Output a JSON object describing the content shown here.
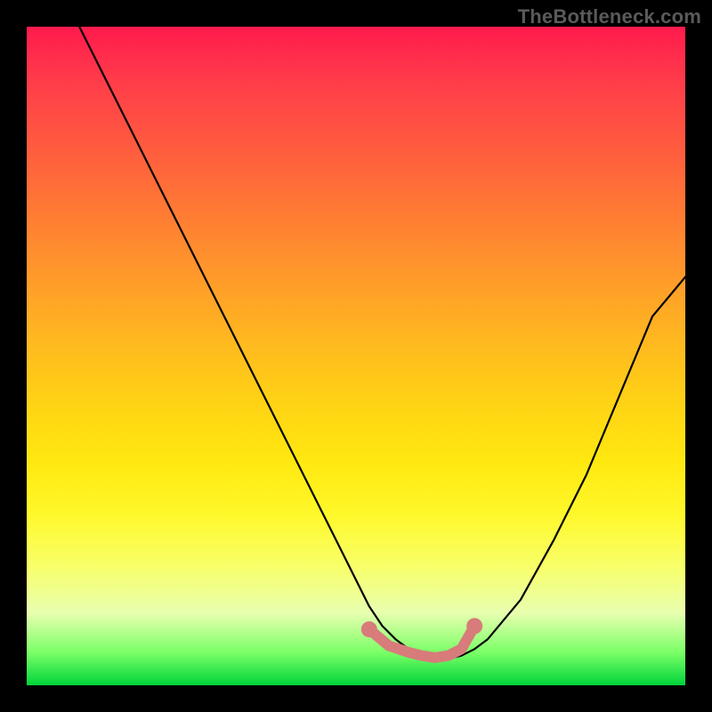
{
  "watermark": {
    "text": "TheBottleneck.com"
  },
  "chart_data": {
    "type": "line",
    "title": "",
    "xlabel": "",
    "ylabel": "",
    "xlim": [
      0,
      100
    ],
    "ylim": [
      0,
      100
    ],
    "grid": false,
    "legend": false,
    "series": [
      {
        "name": "bottleneck-curve",
        "color": "#000000",
        "x": [
          8,
          12,
          16,
          20,
          25,
          30,
          35,
          40,
          45,
          50,
          52,
          54,
          56,
          58,
          60,
          62,
          64,
          66,
          68,
          70,
          75,
          80,
          85,
          90,
          95,
          100
        ],
        "y": [
          100,
          92,
          84,
          76,
          66,
          56,
          46,
          36,
          26,
          16,
          12,
          9,
          7,
          5.5,
          4.5,
          4,
          4,
          4.5,
          5.5,
          7,
          13,
          22,
          32,
          44,
          56,
          62
        ]
      },
      {
        "name": "optimal-range-marker",
        "color": "#d87b7b",
        "x": [
          52,
          55,
          58,
          60,
          62,
          64,
          66,
          68
        ],
        "y": [
          8.5,
          6,
          5,
          4.5,
          4.2,
          4.5,
          5.5,
          9
        ]
      }
    ],
    "annotations": []
  }
}
